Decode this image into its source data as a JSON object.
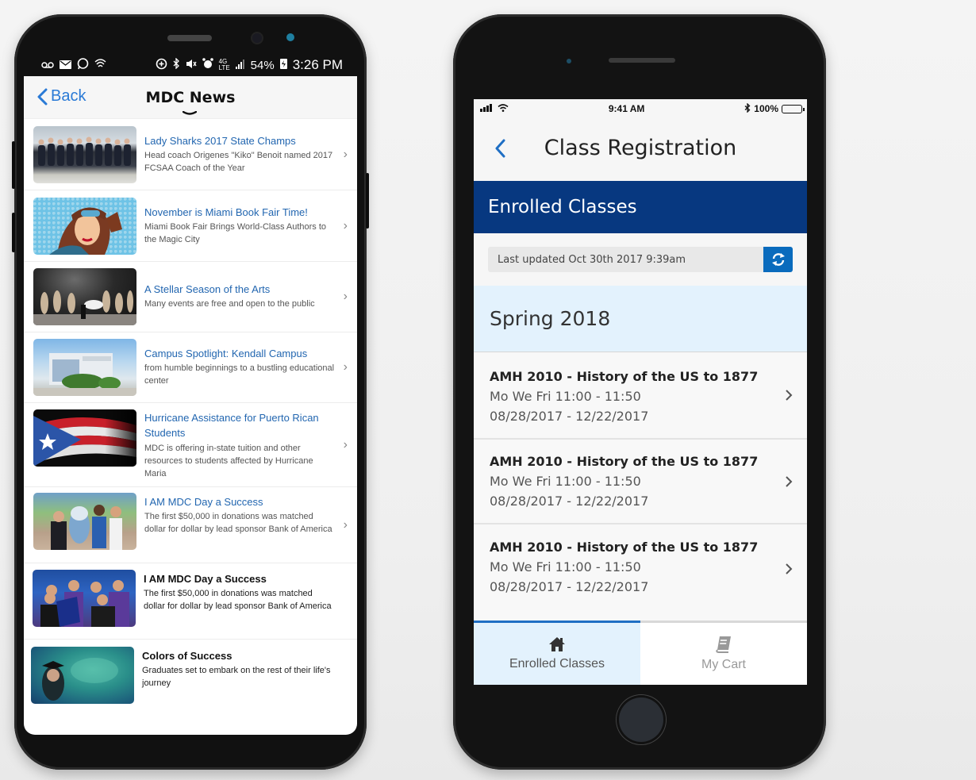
{
  "android": {
    "status_bar": {
      "left_icons": [
        "voicemail-icon",
        "mail-icon",
        "whatsapp-icon",
        "wifi-icon"
      ],
      "right_icons": [
        "data-saver-icon",
        "bluetooth-icon",
        "mute-icon",
        "alarm-icon",
        "4g-lte-icon",
        "signal-icon"
      ],
      "battery": "54%",
      "time": "3:26 PM"
    },
    "nav": {
      "back_label": "Back",
      "title": "MDC News"
    },
    "news": [
      {
        "title": "Lady Sharks 2017 State Champs",
        "desc": "Head coach Origenes \"Kiko\" Benoit named 2017 FCSAA Coach of the Year",
        "style": "link",
        "thumb": "volleyball-team-photo"
      },
      {
        "title": "November is Miami Book Fair Time!",
        "desc": "Miami Book Fair Brings World-Class Authors to the Magic City",
        "style": "link",
        "thumb": "pop-art-aviator-illustration"
      },
      {
        "title": "A Stellar Season of the Arts",
        "desc": "Many events are free and open to the public",
        "style": "link",
        "thumb": "dance-performance-photo"
      },
      {
        "title": "Campus Spotlight: Kendall Campus",
        "desc": "from humble beginnings to a bustling educational center",
        "style": "link",
        "thumb": "campus-building-photo"
      },
      {
        "title": "Hurricane Assistance for Puerto Rican Students",
        "desc": "MDC is offering in-state tuition and other resources to students affected by Hurricane Maria",
        "style": "link",
        "thumb": "puerto-rico-flag-photo"
      },
      {
        "title": "I AM MDC Day a Success",
        "desc": "The first $50,000 in donations was matched dollar for dollar by lead sponsor Bank of America",
        "style": "link",
        "thumb": "mascot-group-photo"
      },
      {
        "title": "I AM MDC Day a Success",
        "desc": "The first $50,000 in donations was matched dollar for dollar by lead sponsor Bank of America",
        "style": "dark",
        "thumb": "soccer-players-photo"
      },
      {
        "title": "Colors of Success",
        "desc": "Graduates set to embark on the rest of their life's journey",
        "style": "dark",
        "thumb": "graduate-color-smoke-photo"
      }
    ]
  },
  "iphone": {
    "status_bar": {
      "time": "9:41 AM",
      "battery": "100%"
    },
    "nav": {
      "title": "Class Registration"
    },
    "section_title": "Enrolled Classes",
    "last_updated": "Last updated Oct 30th 2017 9:39am",
    "term": "Spring 2018",
    "classes": [
      {
        "name": "AMH 2010 - History of the US to 1877",
        "schedule": "Mo We Fri 11:00 - 11:50",
        "dates": "08/28/2017 - 12/22/2017"
      },
      {
        "name": "AMH 2010 - History of the US to 1877",
        "schedule": "Mo We Fri 11:00 - 11:50",
        "dates": "08/28/2017 - 12/22/2017"
      },
      {
        "name": "AMH 2010 - History of the US to 1877",
        "schedule": "Mo We Fri 11:00 - 11:50",
        "dates": "08/28/2017 - 12/22/2017"
      }
    ],
    "tabs": [
      {
        "label": "Enrolled Classes",
        "icon": "home-icon",
        "active": true
      },
      {
        "label": "My Cart",
        "icon": "book-icon",
        "active": false
      }
    ]
  },
  "colors": {
    "link_blue": "#2266b0",
    "ios_blue": "#1f6fc4",
    "banner_navy": "#073880",
    "refresh_blue": "#0a6bbd",
    "term_bg": "#e3f2fd"
  }
}
